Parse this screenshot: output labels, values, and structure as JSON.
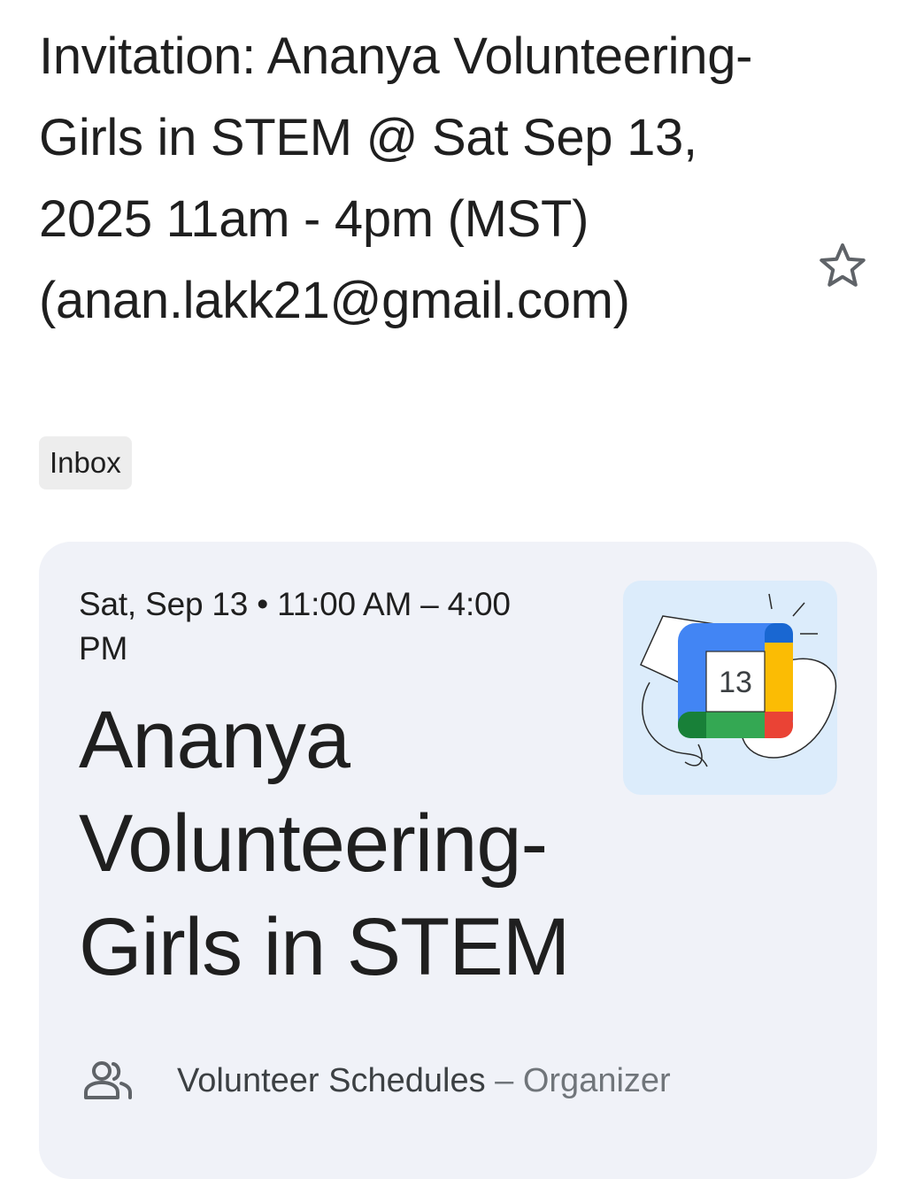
{
  "email": {
    "subject": "Invitation: Ananya Volunteering- Girls in STEM @ Sat Sep 13, 2025 11am - 4pm (MST) (anan.lakk21@gmail.com)",
    "label": "Inbox",
    "star_icon": "star-outline-icon"
  },
  "invite_card": {
    "when": "Sat, Sep 13 • 11:00 AM – 4:00 PM",
    "title": "Ananya Volunteering- Girls in STEM",
    "calendar_day": "13",
    "organizer_icon": "people-icon",
    "organizer_name": "Volunteer Schedules",
    "organizer_separator": " – ",
    "organizer_role": "Organizer"
  },
  "colors": {
    "card_background": "#f0f2f8",
    "chip_background": "#ededed",
    "calendar_blue": "#4285f4",
    "calendar_green": "#34a853",
    "calendar_yellow": "#fbbc04",
    "calendar_red": "#ea4335"
  }
}
